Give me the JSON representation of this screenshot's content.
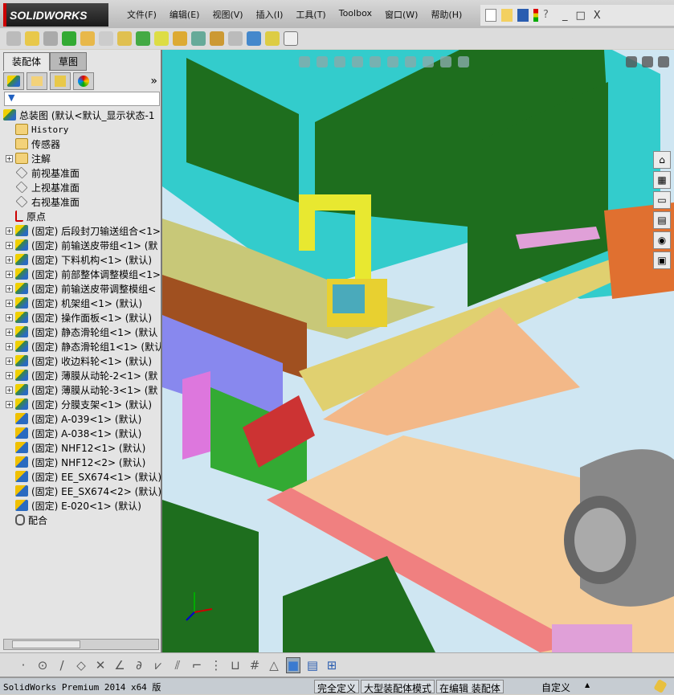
{
  "app": {
    "logo": "SOLIDWORKS"
  },
  "menu": [
    "文件(F)",
    "编辑(E)",
    "视图(V)",
    "插入(I)",
    "工具(T)",
    "Toolbox",
    "窗口(W)",
    "帮助(H)"
  ],
  "window_controls": {
    "minimize": "_",
    "restore": "□",
    "close": "X"
  },
  "panel": {
    "tabs": [
      "装配体",
      "草图"
    ],
    "more": "»",
    "filter_icon": "funnel-icon",
    "tree": [
      {
        "label": "总装图  (默认<默认_显示状态-1",
        "icon": "assembly",
        "expand": false,
        "root": true
      },
      {
        "label": "History",
        "icon": "folder",
        "expand": false,
        "mono": true
      },
      {
        "label": "传感器",
        "icon": "folder",
        "expand": false
      },
      {
        "label": "注解",
        "icon": "folder",
        "expand": true
      },
      {
        "label": "前视基准面",
        "icon": "plane",
        "expand": false
      },
      {
        "label": "上视基准面",
        "icon": "plane",
        "expand": false
      },
      {
        "label": "右视基准面",
        "icon": "plane",
        "expand": false
      },
      {
        "label": "原点",
        "icon": "origin",
        "expand": false
      },
      {
        "label": "(固定) 后段封刀输送组合<1>",
        "icon": "asm",
        "expand": true
      },
      {
        "label": "(固定) 前输送皮带组<1> (默",
        "icon": "asm",
        "expand": true
      },
      {
        "label": "(固定) 下料机构<1> (默认)",
        "icon": "asm",
        "expand": true
      },
      {
        "label": "(固定) 前部整体调整模组<1>",
        "icon": "asm",
        "expand": true
      },
      {
        "label": "(固定) 前输送皮带调整模组<",
        "icon": "asm",
        "expand": true
      },
      {
        "label": "(固定) 机架组<1> (默认)",
        "icon": "asm",
        "expand": true
      },
      {
        "label": "(固定) 操作面板<1> (默认)",
        "icon": "asm",
        "expand": true
      },
      {
        "label": "(固定) 静态滑轮组<1> (默认",
        "icon": "asm",
        "expand": true
      },
      {
        "label": "(固定) 静态滑轮组1<1> (默认",
        "icon": "asm",
        "expand": true
      },
      {
        "label": "(固定) 收边料轮<1> (默认)",
        "icon": "asm",
        "expand": true
      },
      {
        "label": "(固定) 薄膜从动轮-2<1> (默",
        "icon": "asm",
        "expand": true
      },
      {
        "label": "(固定) 薄膜从动轮-3<1> (默",
        "icon": "asm",
        "expand": true
      },
      {
        "label": "(固定) 分膜支架<1> (默认)",
        "icon": "asm",
        "expand": true
      },
      {
        "label": "(固定) A-039<1> (默认)",
        "icon": "part",
        "expand": false
      },
      {
        "label": "(固定) A-038<1> (默认)",
        "icon": "part",
        "expand": false
      },
      {
        "label": "(固定) NHF12<1> (默认)",
        "icon": "part",
        "expand": false
      },
      {
        "label": "(固定) NHF12<2> (默认)",
        "icon": "part",
        "expand": false
      },
      {
        "label": "(固定) EE_SX674<1> (默认)",
        "icon": "part",
        "expand": false
      },
      {
        "label": "(固定) EE_SX674<2> (默认)",
        "icon": "part",
        "expand": false
      },
      {
        "label": "(固定) E-020<1> (默认)",
        "icon": "part",
        "expand": false
      },
      {
        "label": "配合",
        "icon": "mate",
        "expand": false
      }
    ]
  },
  "status": {
    "version": "SolidWorks Premium 2014 x64 版",
    "defined": "完全定义",
    "mode": "大型装配体模式",
    "editing": "在编辑 装配体",
    "units": "自定义",
    "units_arrow": "▲"
  },
  "colors": {
    "frame": "#33cccc",
    "panel_green": "#1e6e1e",
    "plate": "#f5cc99",
    "accent_red": "#cc0000"
  }
}
